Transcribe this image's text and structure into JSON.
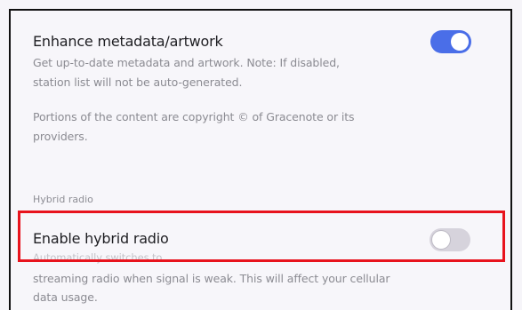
{
  "settings": {
    "enhance": {
      "title": "Enhance metadata/artwork",
      "desc_line1": "Get up-to-date metadata and artwork. Note: If disabled,",
      "desc_line2": "station list will not be auto-generated.",
      "enabled": true
    },
    "copyright": {
      "line1": "Portions of the content are copyright © of Gracenote or its",
      "line2": "providers."
    },
    "hybrid_section": {
      "header": "Hybrid radio"
    },
    "hybrid": {
      "title": "Enable hybrid radio",
      "desc_line1": "Automatically switches to",
      "desc_line2": "streaming radio when signal is weak. This will affect your cellular",
      "desc_line3": "data usage.",
      "enabled": false
    }
  },
  "colors": {
    "accent": "#4a6ee8",
    "highlight": "#e8131d"
  }
}
